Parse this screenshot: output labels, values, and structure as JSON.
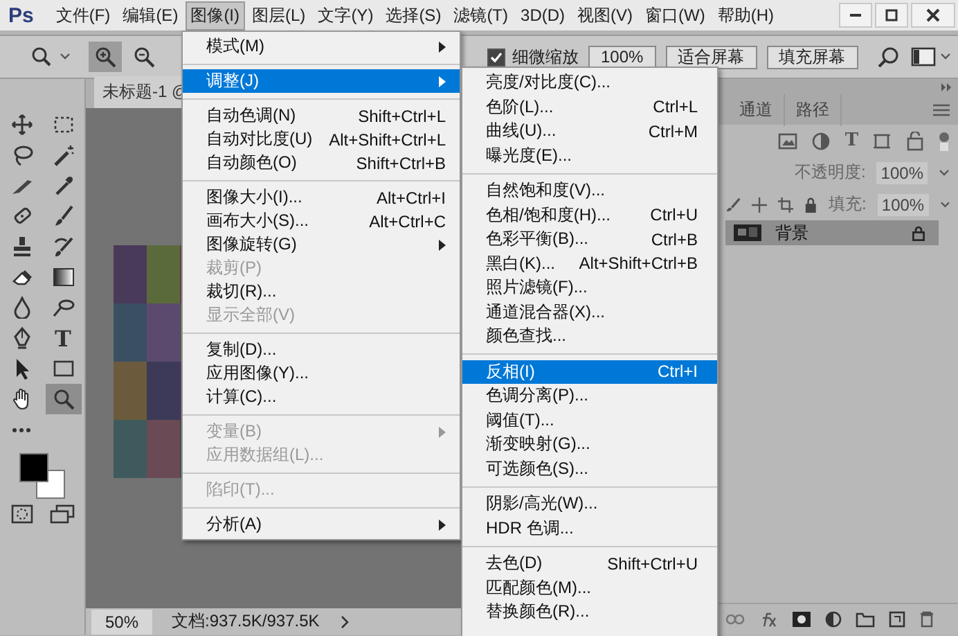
{
  "app": {
    "logo": "Ps"
  },
  "menubar": [
    {
      "label": "文件(F)",
      "selected": false
    },
    {
      "label": "编辑(E)",
      "selected": false
    },
    {
      "label": "图像(I)",
      "selected": true
    },
    {
      "label": "图层(L)",
      "selected": false
    },
    {
      "label": "文字(Y)",
      "selected": false
    },
    {
      "label": "选择(S)",
      "selected": false
    },
    {
      "label": "滤镜(T)",
      "selected": false
    },
    {
      "label": "3D(D)",
      "selected": false
    },
    {
      "label": "视图(V)",
      "selected": false
    },
    {
      "label": "窗口(W)",
      "selected": false
    },
    {
      "label": "帮助(H)",
      "selected": false
    }
  ],
  "options_bar": {
    "tools": [
      {
        "kind": "zoom-menu",
        "selected": false
      },
      {
        "kind": "zoom-in",
        "selected": true
      },
      {
        "kind": "zoom-out",
        "selected": false
      }
    ],
    "scrubby_zoom": {
      "label": "细微缩放",
      "checked": true
    },
    "buttons": [
      "100%",
      "适合屏幕",
      "填充屏幕"
    ]
  },
  "toolbox": {
    "tools": [
      {
        "kind": "move",
        "selected": false
      },
      {
        "kind": "marquee",
        "selected": false
      },
      {
        "kind": "lasso",
        "selected": false
      },
      {
        "kind": "wand",
        "selected": false
      },
      {
        "kind": "knife",
        "selected": false
      },
      {
        "kind": "eyedropper",
        "selected": false
      },
      {
        "kind": "bandage",
        "selected": false
      },
      {
        "kind": "brush",
        "selected": false
      },
      {
        "kind": "stamp",
        "selected": false
      },
      {
        "kind": "history-brush",
        "selected": false
      },
      {
        "kind": "eraser",
        "selected": false
      },
      {
        "kind": "gradient",
        "selected": false
      },
      {
        "kind": "drop",
        "selected": false
      },
      {
        "kind": "dodge",
        "selected": false
      },
      {
        "kind": "pen",
        "selected": false
      },
      {
        "kind": "type",
        "glyph": "T",
        "selected": false
      },
      {
        "kind": "arrow",
        "selected": false
      },
      {
        "kind": "rectangle",
        "selected": false
      },
      {
        "kind": "hand",
        "selected": false
      },
      {
        "kind": "zoom",
        "selected": true
      },
      {
        "kind": "more",
        "selected": false
      }
    ],
    "swatches": [
      {
        "color": "#000000"
      },
      {
        "color": "#ffffff"
      }
    ]
  },
  "document": {
    "tab": "未标题-1 @",
    "zoom": "50%",
    "info": "文档:937.5K/937.5K"
  },
  "layers_panel": {
    "tabs": [
      {
        "label": "通道",
        "selected": false
      },
      {
        "label": "路径",
        "selected": false
      }
    ],
    "filter_icons": [
      {
        "kind": "pixel"
      },
      {
        "kind": "adjustment"
      },
      {
        "kind": "type",
        "glyph": "T"
      },
      {
        "kind": "shape"
      },
      {
        "kind": "smart"
      }
    ],
    "opacity": {
      "label": "不透明度:",
      "value": "100%"
    },
    "fill": {
      "label": "填充:",
      "value": "100%"
    },
    "layers": [
      {
        "name": "背景",
        "selected": true,
        "locked": true
      }
    ]
  },
  "image_menu": {
    "items": [
      {
        "kind": "item",
        "label": "模式(M)",
        "submenu": true,
        "disabled": false,
        "selected": false
      },
      {
        "kind": "separator"
      },
      {
        "kind": "item",
        "label": "调整(J)",
        "submenu": true,
        "disabled": false,
        "selected": true
      },
      {
        "kind": "separator"
      },
      {
        "kind": "item",
        "label": "自动色调(N)",
        "shortcut": "Shift+Ctrl+L",
        "disabled": false,
        "selected": false
      },
      {
        "kind": "item",
        "label": "自动对比度(U)",
        "shortcut": "Alt+Shift+Ctrl+L",
        "disabled": false,
        "selected": false
      },
      {
        "kind": "item",
        "label": "自动颜色(O)",
        "shortcut": "Shift+Ctrl+B",
        "disabled": false,
        "selected": false
      },
      {
        "kind": "separator"
      },
      {
        "kind": "item",
        "label": "图像大小(I)...",
        "shortcut": "Alt+Ctrl+I",
        "disabled": false,
        "selected": false
      },
      {
        "kind": "item",
        "label": "画布大小(S)...",
        "shortcut": "Alt+Ctrl+C",
        "disabled": false,
        "selected": false
      },
      {
        "kind": "item",
        "label": "图像旋转(G)",
        "submenu": true,
        "disabled": false,
        "selected": false
      },
      {
        "kind": "item",
        "label": "裁剪(P)",
        "disabled": true,
        "selected": false
      },
      {
        "kind": "item",
        "label": "裁切(R)...",
        "disabled": false,
        "selected": false
      },
      {
        "kind": "item",
        "label": "显示全部(V)",
        "disabled": true,
        "selected": false
      },
      {
        "kind": "separator"
      },
      {
        "kind": "item",
        "label": "复制(D)...",
        "disabled": false,
        "selected": false
      },
      {
        "kind": "item",
        "label": "应用图像(Y)...",
        "disabled": false,
        "selected": false
      },
      {
        "kind": "item",
        "label": "计算(C)...",
        "disabled": false,
        "selected": false
      },
      {
        "kind": "separator"
      },
      {
        "kind": "item",
        "label": "变量(B)",
        "submenu": true,
        "disabled": true,
        "selected": false
      },
      {
        "kind": "item",
        "label": "应用数据组(L)...",
        "disabled": true,
        "selected": false
      },
      {
        "kind": "separator"
      },
      {
        "kind": "item",
        "label": "陷印(T)...",
        "disabled": true,
        "selected": false
      },
      {
        "kind": "separator"
      },
      {
        "kind": "item",
        "label": "分析(A)",
        "submenu": true,
        "disabled": false,
        "selected": false
      }
    ]
  },
  "adjustments_menu": {
    "items": [
      {
        "kind": "item",
        "label": "亮度/对比度(C)...",
        "disabled": false,
        "selected": false
      },
      {
        "kind": "item",
        "label": "色阶(L)...",
        "shortcut": "Ctrl+L",
        "disabled": false,
        "selected": false
      },
      {
        "kind": "item",
        "label": "曲线(U)...",
        "shortcut": "Ctrl+M",
        "disabled": false,
        "selected": false
      },
      {
        "kind": "item",
        "label": "曝光度(E)...",
        "disabled": false,
        "selected": false
      },
      {
        "kind": "separator"
      },
      {
        "kind": "item",
        "label": "自然饱和度(V)...",
        "disabled": false,
        "selected": false
      },
      {
        "kind": "item",
        "label": "色相/饱和度(H)...",
        "shortcut": "Ctrl+U",
        "disabled": false,
        "selected": false
      },
      {
        "kind": "item",
        "label": "色彩平衡(B)...",
        "shortcut": "Ctrl+B",
        "disabled": false,
        "selected": false
      },
      {
        "kind": "item",
        "label": "黑白(K)...",
        "shortcut": "Alt+Shift+Ctrl+B",
        "disabled": false,
        "selected": false
      },
      {
        "kind": "item",
        "label": "照片滤镜(F)...",
        "disabled": false,
        "selected": false
      },
      {
        "kind": "item",
        "label": "通道混合器(X)...",
        "disabled": false,
        "selected": false
      },
      {
        "kind": "item",
        "label": "颜色查找...",
        "disabled": false,
        "selected": false
      },
      {
        "kind": "separator"
      },
      {
        "kind": "item",
        "label": "反相(I)",
        "shortcut": "Ctrl+I",
        "disabled": false,
        "selected": true
      },
      {
        "kind": "item",
        "label": "色调分离(P)...",
        "disabled": false,
        "selected": false
      },
      {
        "kind": "item",
        "label": "阈值(T)...",
        "disabled": false,
        "selected": false
      },
      {
        "kind": "item",
        "label": "渐变映射(G)...",
        "disabled": false,
        "selected": false
      },
      {
        "kind": "item",
        "label": "可选颜色(S)...",
        "disabled": false,
        "selected": false
      },
      {
        "kind": "separator"
      },
      {
        "kind": "item",
        "label": "阴影/高光(W)...",
        "disabled": false,
        "selected": false
      },
      {
        "kind": "item",
        "label": "HDR 色调...",
        "disabled": false,
        "selected": false
      },
      {
        "kind": "separator"
      },
      {
        "kind": "item",
        "label": "去色(D)",
        "shortcut": "Shift+Ctrl+U",
        "disabled": false,
        "selected": false
      },
      {
        "kind": "item",
        "label": "匹配颜色(M)...",
        "disabled": false,
        "selected": false
      },
      {
        "kind": "item",
        "label": "替换颜色(R)...",
        "disabled": false,
        "selected": false
      }
    ]
  }
}
